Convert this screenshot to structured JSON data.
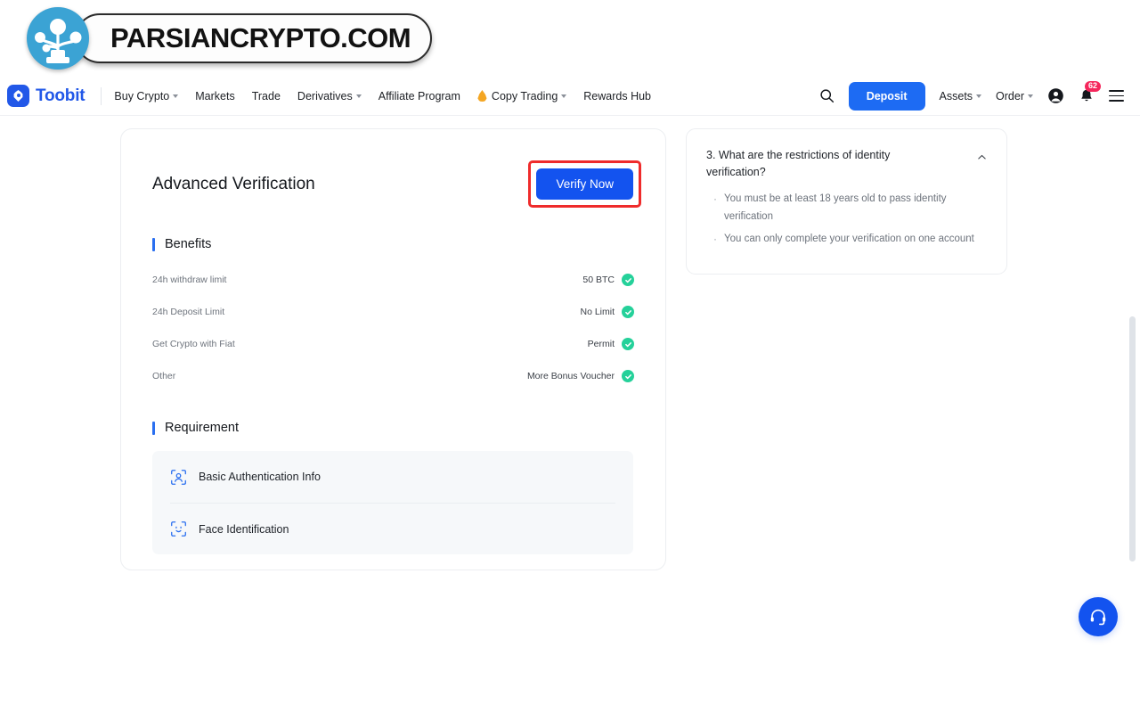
{
  "watermark": {
    "text": "PARSIANCRYPTO.COM",
    "logo_icon": "network-tree-icon",
    "circle_color": "#3ba3d4"
  },
  "header": {
    "brand": {
      "name": "Toobit",
      "logo_icon": "toobit-logo-icon",
      "color": "#2258e8"
    },
    "nav": [
      {
        "label": "Buy Crypto",
        "has_caret": true,
        "icon": null
      },
      {
        "label": "Markets",
        "has_caret": false,
        "icon": null
      },
      {
        "label": "Trade",
        "has_caret": false,
        "icon": null
      },
      {
        "label": "Derivatives",
        "has_caret": true,
        "icon": null
      },
      {
        "label": "Affiliate Program",
        "has_caret": false,
        "icon": null
      },
      {
        "label": "Copy Trading",
        "has_caret": true,
        "icon": "flame-icon"
      },
      {
        "label": "Rewards Hub",
        "has_caret": false,
        "icon": null
      }
    ],
    "search_icon": "search-icon",
    "deposit_label": "Deposit",
    "deposit_color": "#1d6bf3",
    "assets_label": "Assets",
    "order_label": "Order",
    "account_icon": "user-avatar-icon",
    "bell_icon": "bell-icon",
    "notification_count": "62",
    "badge_color": "#f5275c",
    "menu_icon": "hamburger-menu-icon"
  },
  "card": {
    "title": "Advanced Verification",
    "verify_label": "Verify Now",
    "verify_color": "#1353ef",
    "highlight_color": "#ef2b2b",
    "benefits_heading": "Benefits",
    "benefits": [
      {
        "label": "24h withdraw limit",
        "value": "50 BTC",
        "checked": true
      },
      {
        "label": "24h Deposit Limit",
        "value": "No Limit",
        "checked": true
      },
      {
        "label": "Get Crypto with Fiat",
        "value": "Permit",
        "checked": true
      },
      {
        "label": "Other",
        "value": "More Bonus Voucher",
        "checked": true
      }
    ],
    "check_color": "#25d19a",
    "requirement_heading": "Requirement",
    "requirements": [
      {
        "label": "Basic Authentication Info",
        "icon": "id-scan-person-icon"
      },
      {
        "label": "Face Identification",
        "icon": "face-scan-icon"
      }
    ]
  },
  "faq": {
    "question": "3. What are the restrictions of identity verification?",
    "toggle_icon": "chevron-up-icon",
    "answers": [
      "You must be at least 18 years old to pass identity verification",
      "You can only complete your verification on one account"
    ]
  },
  "support": {
    "icon": "headset-icon",
    "color": "#1353ef"
  },
  "scrollbar": {
    "thumb_color": "#dfe3e8"
  }
}
